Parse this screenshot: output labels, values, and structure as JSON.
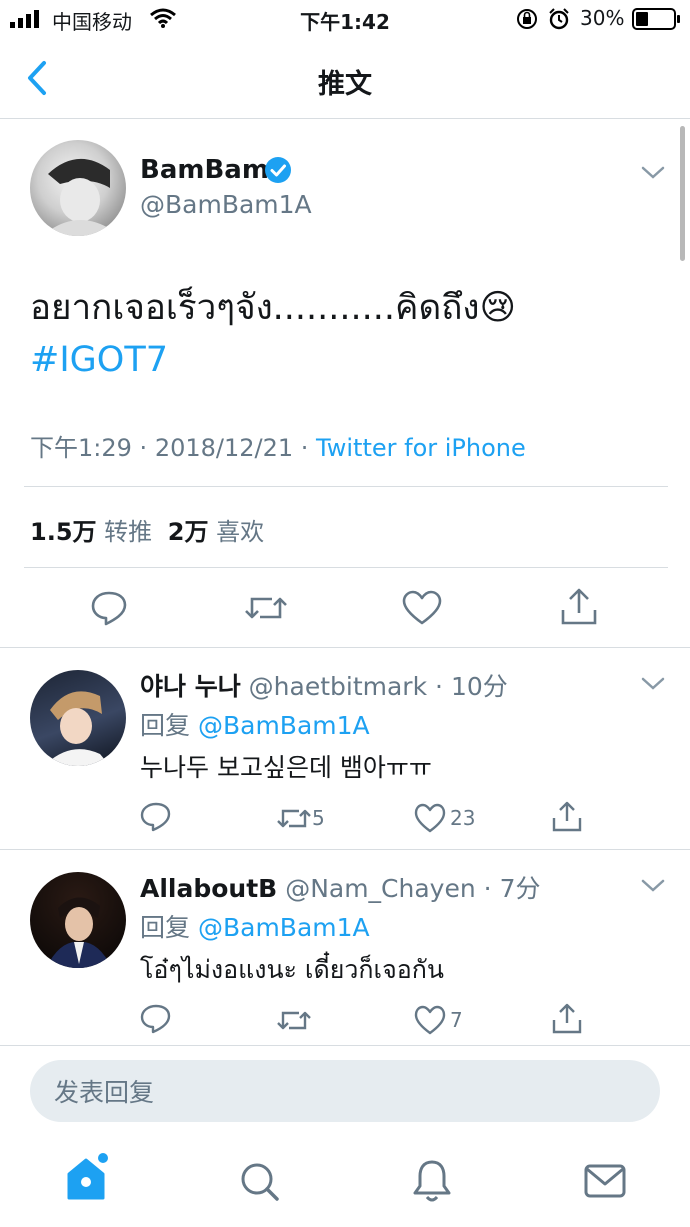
{
  "status_bar": {
    "carrier": "中国移动",
    "time": "下午1:42",
    "battery": "30%"
  },
  "nav": {
    "title": "推文"
  },
  "tweet": {
    "author_name": "BamBam",
    "handle": "@BamBam1A",
    "text": "อยากเจอเร็วๆจัง...........คิดถึง",
    "emoji": "😢",
    "hashtag": "#IGOT7",
    "time": "下午1:29",
    "date": "2018/12/21",
    "source": "Twitter for iPhone",
    "retweets_count": "1.5万",
    "retweets_label": "转推",
    "likes_count": "2万",
    "likes_label": "喜欢"
  },
  "replies": [
    {
      "name": "야나 누나",
      "handle": "@haetbitmark",
      "time": "10分",
      "reply_prefix": "回复",
      "reply_to": "@BamBam1A",
      "text": "누나두 보고싶은데 뱀아ㅠㅠ",
      "retweets": "5",
      "likes": "23"
    },
    {
      "name": "AllaboutB",
      "handle": "@Nam_Chayen",
      "time": "7分",
      "reply_prefix": "回复",
      "reply_to": "@BamBam1A",
      "text": "โอ๋ๆไม่งอแงนะ เดี๋ยวก็เจอกัน",
      "retweets": "",
      "likes": "7"
    }
  ],
  "compose": {
    "placeholder": "发表回复"
  },
  "colors": {
    "accent": "#1da1f2",
    "muted": "#657786",
    "divider": "#d8dde1"
  },
  "icons": {
    "signal": "signal-icon",
    "wifi": "wifi-icon",
    "lock": "orientation-lock-icon",
    "alarm": "alarm-icon",
    "battery": "battery-icon",
    "back": "back-chevron-icon",
    "verified": "verified-badge-icon",
    "more": "chevron-down-icon",
    "reply": "reply-icon",
    "retweet": "retweet-icon",
    "like": "heart-icon",
    "share": "share-icon",
    "home": "home-icon",
    "search": "search-icon",
    "notifications": "bell-icon",
    "messages": "mail-icon"
  }
}
